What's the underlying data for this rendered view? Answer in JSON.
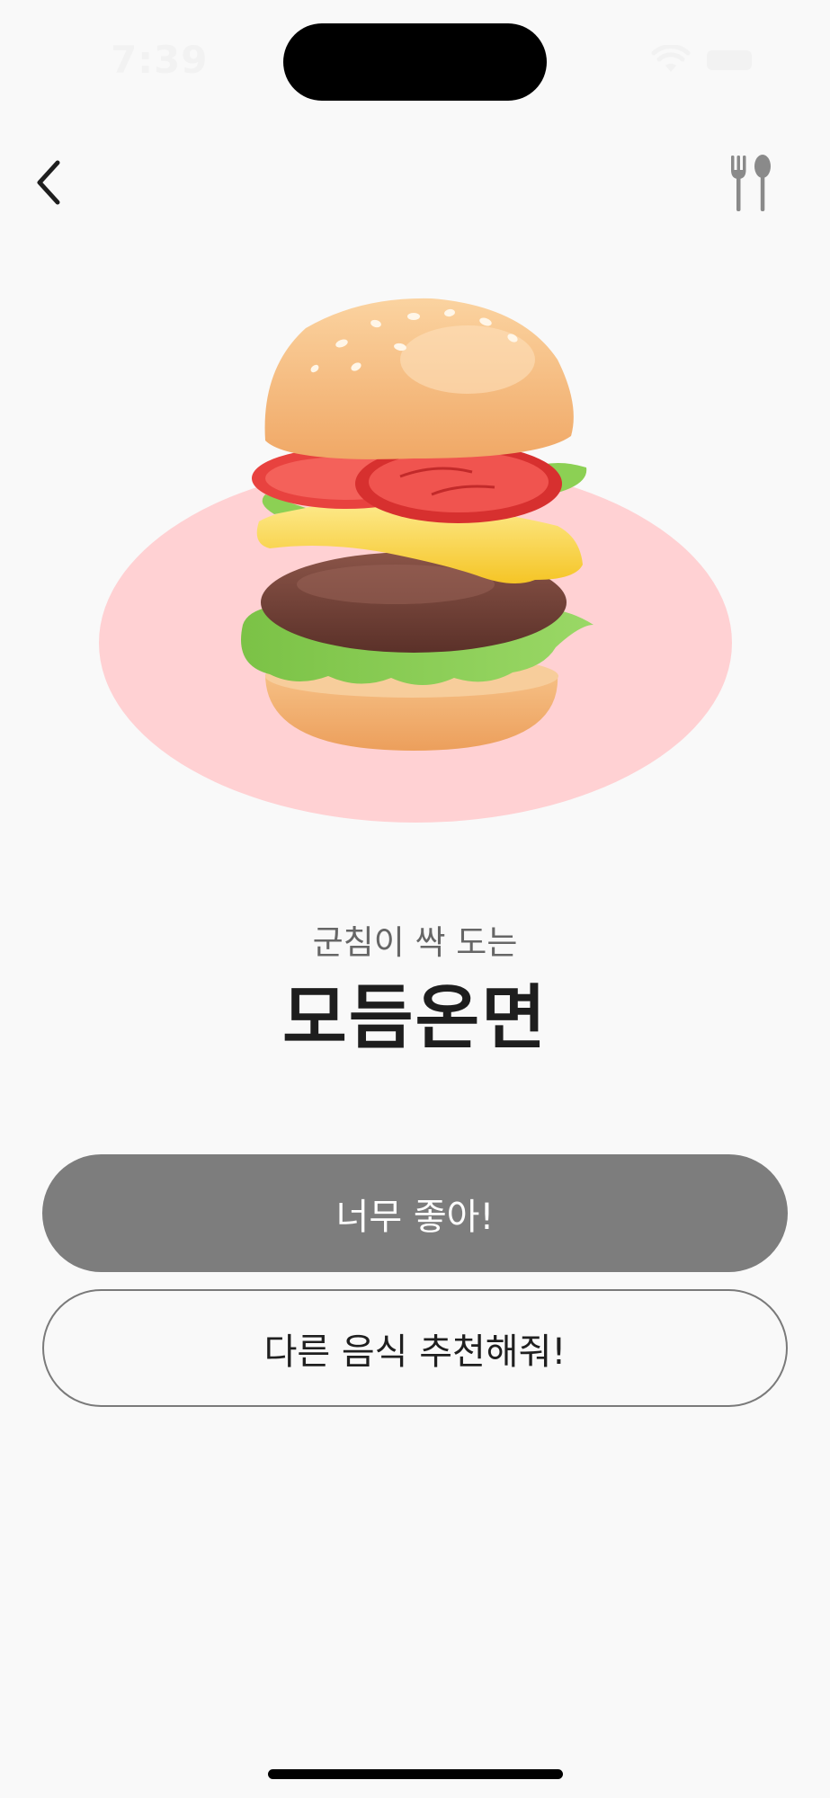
{
  "status_bar": {
    "time": "7:39"
  },
  "nav": {
    "back_icon": "chevron-left-icon",
    "right_icon": "fork-spoon-icon"
  },
  "hero": {
    "image": "hamburger-3d-illustration",
    "backdrop_color": "#ffd1d3"
  },
  "recommendation": {
    "subtitle": "군침이 싹 도는",
    "food_name": "모듬온면"
  },
  "actions": {
    "accept_label": "너무 좋아!",
    "reroll_label": "다른 음식 추천해줘!"
  },
  "colors": {
    "background": "#f9f9f9",
    "primary_button": "#7d7d7d",
    "title_text": "#1e1e1e"
  }
}
